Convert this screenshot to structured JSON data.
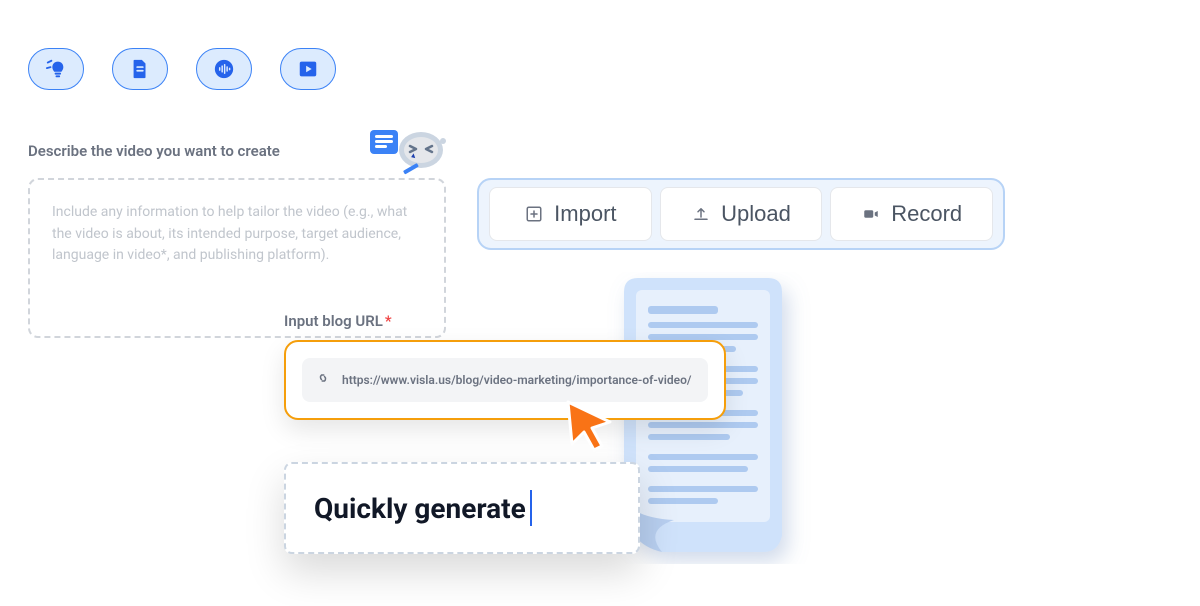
{
  "tabs": [
    {
      "name": "idea-lightbulb-icon"
    },
    {
      "name": "document-icon"
    },
    {
      "name": "audio-wave-icon"
    },
    {
      "name": "video-play-icon"
    }
  ],
  "describe": {
    "label": "Describe the video you want to create",
    "placeholder": "Include any information to help tailor the video (e.g., what the video is about,  its intended purpose, target audience, language in video*, and publishing platform)."
  },
  "actions": {
    "import_label": "Import",
    "upload_label": "Upload",
    "record_label": "Record"
  },
  "blog": {
    "label": "Input blog URL",
    "required_mark": "*",
    "url": "https://www.visla.us/blog/video-marketing/importance-of-video/"
  },
  "generate": {
    "text": "Quickly generate",
    "typing": true
  }
}
